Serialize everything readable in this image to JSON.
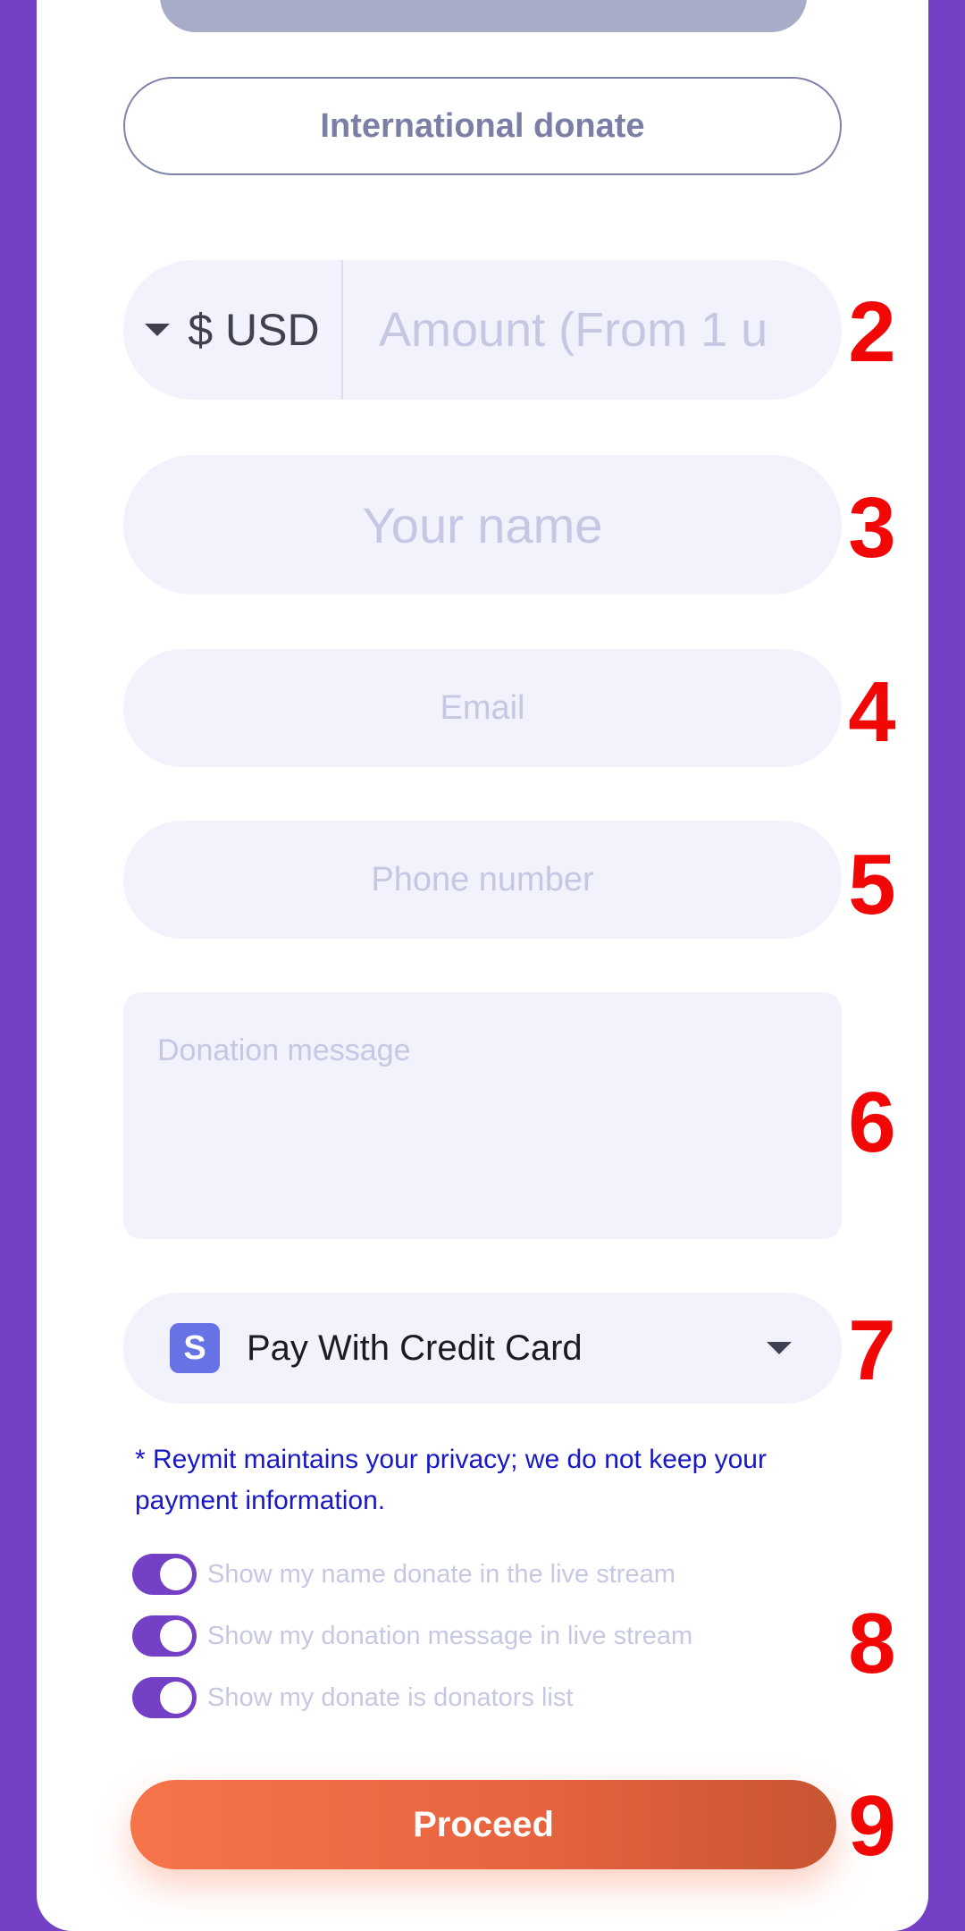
{
  "form": {
    "international_donate_label": "International donate",
    "amount": {
      "currency_label": "$ USD",
      "placeholder": "Amount (From 1 u"
    },
    "name_placeholder": "Your name",
    "email_placeholder": "Email",
    "phone_placeholder": "Phone number",
    "message_placeholder": "Donation message",
    "payment": {
      "icon": "stripe-logo",
      "icon_letter": "S",
      "selected": "Pay With Credit Card"
    },
    "privacy_note": "* Reymit maintains your privacy; we do not keep your payment information.",
    "toggles": [
      {
        "label": "Show my name donate in the live stream",
        "on": true
      },
      {
        "label": "Show my donation message in live stream",
        "on": true
      },
      {
        "label": "Show my donate is donators list",
        "on": true
      }
    ],
    "proceed_label": "Proceed"
  },
  "annotations": [
    "2",
    "3",
    "4",
    "5",
    "6",
    "7",
    "8",
    "9"
  ],
  "colors": {
    "background": "#7441c6",
    "field": "#f1f2fb",
    "placeholder": "#c6c8e3",
    "toggle_on": "#7441c6",
    "privacy_text": "#1818c6",
    "proceed_start": "#f7734a",
    "proceed_end": "#c85532",
    "annotation": "#f20707"
  }
}
